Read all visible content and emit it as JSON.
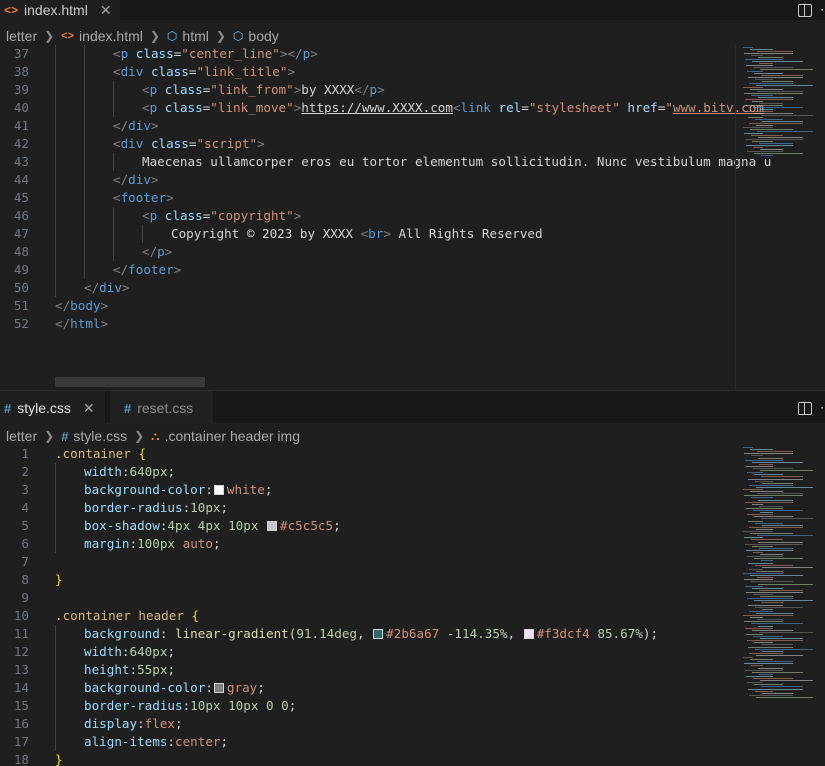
{
  "top_tabs": [
    {
      "icon": "html-file-icon",
      "label": "index.html",
      "close": "✕"
    }
  ],
  "top_breadcrumb": {
    "items": [
      {
        "label": "letter",
        "icon": ""
      },
      {
        "label": "index.html",
        "icon": "html-file-icon"
      },
      {
        "label": "html",
        "icon": "cube-icon"
      },
      {
        "label": "body",
        "icon": "cube-icon"
      }
    ]
  },
  "bottom_tabs": [
    {
      "icon": "#",
      "label": "style.css",
      "close": "✕",
      "active": true
    },
    {
      "icon": "#",
      "label": "reset.css",
      "close": "",
      "active": false
    }
  ],
  "bottom_breadcrumb": {
    "items": [
      {
        "label": "letter",
        "icon": ""
      },
      {
        "label": "style.css",
        "icon": "#"
      },
      {
        "label": ".container header img",
        "icon": "selector-icon"
      }
    ]
  },
  "html_editor": {
    "lines": [
      {
        "n": "37",
        "indent": 2,
        "tokens": [
          [
            "br",
            "<"
          ],
          [
            "tg",
            "p"
          ],
          [
            "tx",
            " "
          ],
          [
            "at",
            "class"
          ],
          [
            "tx",
            "="
          ],
          [
            "st",
            "\"center_line\""
          ],
          [
            "br",
            ">"
          ],
          [
            "br",
            "</"
          ],
          [
            "tg",
            "p"
          ],
          [
            "br",
            ">"
          ]
        ]
      },
      {
        "n": "38",
        "indent": 2,
        "tokens": [
          [
            "br",
            "<"
          ],
          [
            "tg",
            "div"
          ],
          [
            "tx",
            " "
          ],
          [
            "at",
            "class"
          ],
          [
            "tx",
            "="
          ],
          [
            "st",
            "\"link_title\""
          ],
          [
            "br",
            ">"
          ]
        ]
      },
      {
        "n": "39",
        "indent": 3,
        "tokens": [
          [
            "br",
            "<"
          ],
          [
            "tg",
            "p"
          ],
          [
            "tx",
            " "
          ],
          [
            "at",
            "class"
          ],
          [
            "tx",
            "="
          ],
          [
            "st",
            "\"link_from\""
          ],
          [
            "br",
            ">"
          ],
          [
            "tx",
            "by XXXX"
          ],
          [
            "br",
            "</"
          ],
          [
            "tg",
            "p"
          ],
          [
            "br",
            ">"
          ]
        ]
      },
      {
        "n": "40",
        "indent": 3,
        "tokens": [
          [
            "br",
            "<"
          ],
          [
            "tg",
            "p"
          ],
          [
            "tx",
            " "
          ],
          [
            "at",
            "class"
          ],
          [
            "tx",
            "="
          ],
          [
            "st",
            "\"link_move\""
          ],
          [
            "br",
            ">"
          ],
          [
            "tx ul",
            "https://www.XXXX.com"
          ],
          [
            "br",
            "<"
          ],
          [
            "tg",
            "link"
          ],
          [
            "tx",
            " "
          ],
          [
            "at",
            "rel"
          ],
          [
            "tx",
            "="
          ],
          [
            "st",
            "\"stylesheet\""
          ],
          [
            "tx",
            " "
          ],
          [
            "at",
            "href"
          ],
          [
            "tx",
            "="
          ],
          [
            "st",
            "\""
          ],
          [
            "st ul",
            "www.bitv.com"
          ]
        ]
      },
      {
        "n": "41",
        "indent": 2,
        "tokens": [
          [
            "br",
            "</"
          ],
          [
            "tg",
            "div"
          ],
          [
            "br",
            ">"
          ]
        ]
      },
      {
        "n": "42",
        "indent": 2,
        "tokens": [
          [
            "br",
            "<"
          ],
          [
            "tg",
            "div"
          ],
          [
            "tx",
            " "
          ],
          [
            "at",
            "class"
          ],
          [
            "tx",
            "="
          ],
          [
            "st",
            "\"script\""
          ],
          [
            "br",
            ">"
          ]
        ]
      },
      {
        "n": "43",
        "indent": 3,
        "tokens": [
          [
            "tx",
            "Maecenas ullamcorper eros eu tortor elementum sollicitudin. Nunc vestibulum magna u"
          ]
        ]
      },
      {
        "n": "44",
        "indent": 2,
        "tokens": [
          [
            "br",
            "</"
          ],
          [
            "tg",
            "div"
          ],
          [
            "br",
            ">"
          ]
        ]
      },
      {
        "n": "45",
        "indent": 2,
        "tokens": [
          [
            "br",
            "<"
          ],
          [
            "tg",
            "footer"
          ],
          [
            "br",
            ">"
          ]
        ]
      },
      {
        "n": "46",
        "indent": 3,
        "tokens": [
          [
            "br",
            "<"
          ],
          [
            "tg",
            "p"
          ],
          [
            "tx",
            " "
          ],
          [
            "at",
            "class"
          ],
          [
            "tx",
            "="
          ],
          [
            "st",
            "\"copyright\""
          ],
          [
            "br",
            ">"
          ]
        ]
      },
      {
        "n": "47",
        "indent": 4,
        "tokens": [
          [
            "tx",
            "Copyright © 2023 by XXXX "
          ],
          [
            "br",
            "<"
          ],
          [
            "tg",
            "br"
          ],
          [
            "br",
            ">"
          ],
          [
            "tx",
            " All Rights Reserved"
          ]
        ]
      },
      {
        "n": "48",
        "indent": 3,
        "tokens": [
          [
            "br",
            "</"
          ],
          [
            "tg",
            "p"
          ],
          [
            "br",
            ">"
          ]
        ]
      },
      {
        "n": "49",
        "indent": 2,
        "tokens": [
          [
            "br",
            "</"
          ],
          [
            "tg",
            "footer"
          ],
          [
            "br",
            ">"
          ]
        ]
      },
      {
        "n": "50",
        "indent": 1,
        "tokens": [
          [
            "br",
            "</"
          ],
          [
            "tg",
            "div"
          ],
          [
            "br",
            ">"
          ]
        ]
      },
      {
        "n": "51",
        "indent": 0,
        "tokens": [
          [
            "br",
            "</"
          ],
          [
            "tg",
            "body"
          ],
          [
            "br",
            ">"
          ]
        ]
      },
      {
        "n": "52",
        "indent": 0,
        "tokens": [
          [
            "br",
            "</"
          ],
          [
            "tg",
            "html"
          ],
          [
            "br",
            ">"
          ]
        ]
      }
    ]
  },
  "css_editor": {
    "lines": [
      {
        "n": "1",
        "indent": 0,
        "tokens": [
          [
            "sel",
            ".container"
          ],
          [
            "tx",
            " "
          ],
          [
            "pb",
            "{"
          ]
        ]
      },
      {
        "n": "2",
        "indent": 1,
        "tokens": [
          [
            "pr",
            "width"
          ],
          [
            "tx",
            ":"
          ],
          [
            "nm",
            "640px"
          ],
          [
            "tx",
            ";"
          ]
        ]
      },
      {
        "n": "3",
        "indent": 1,
        "tokens": [
          [
            "pr",
            "background-color"
          ],
          [
            "tx",
            ":"
          ],
          [
            "sw",
            "#ffffff"
          ],
          [
            "vl",
            "white"
          ],
          [
            "tx",
            ";"
          ]
        ]
      },
      {
        "n": "4",
        "indent": 1,
        "tokens": [
          [
            "pr",
            "border-radius"
          ],
          [
            "tx",
            ":"
          ],
          [
            "nm",
            "10px"
          ],
          [
            "tx",
            ";"
          ]
        ]
      },
      {
        "n": "5",
        "indent": 1,
        "tokens": [
          [
            "pr",
            "box-shadow"
          ],
          [
            "tx",
            ":"
          ],
          [
            "nm",
            "4px 4px 10px"
          ],
          [
            "tx",
            " "
          ],
          [
            "sw",
            "#c5c5c5"
          ],
          [
            "vl",
            "#c5c5c5"
          ],
          [
            "tx",
            ";"
          ]
        ]
      },
      {
        "n": "6",
        "indent": 1,
        "tokens": [
          [
            "pr",
            "margin"
          ],
          [
            "tx",
            ":"
          ],
          [
            "nm",
            "100px"
          ],
          [
            "tx",
            " "
          ],
          [
            "vl",
            "auto"
          ],
          [
            "tx",
            ";"
          ]
        ]
      },
      {
        "n": "7",
        "indent": 0,
        "tokens": []
      },
      {
        "n": "8",
        "indent": 0,
        "tokens": [
          [
            "pb",
            "}"
          ]
        ]
      },
      {
        "n": "9",
        "indent": 0,
        "tokens": []
      },
      {
        "n": "10",
        "indent": 0,
        "tokens": [
          [
            "sel",
            ".container header"
          ],
          [
            "tx",
            " "
          ],
          [
            "pb",
            "{"
          ]
        ]
      },
      {
        "n": "11",
        "indent": 1,
        "tokens": [
          [
            "pr",
            "background"
          ],
          [
            "tx",
            ": "
          ],
          [
            "fn",
            "linear-gradient"
          ],
          [
            "tx",
            "("
          ],
          [
            "nm",
            "91.14deg"
          ],
          [
            "tx",
            ", "
          ],
          [
            "sw",
            "#2b6a67"
          ],
          [
            "vl",
            "#2b6a67"
          ],
          [
            "tx",
            " "
          ],
          [
            "nm",
            "-114.35%"
          ],
          [
            "tx",
            ", "
          ],
          [
            "sw",
            "#f3dcf4"
          ],
          [
            "vl",
            "#f3dcf4"
          ],
          [
            "tx",
            " "
          ],
          [
            "nm",
            "85.67%"
          ],
          [
            "tx",
            ");"
          ]
        ]
      },
      {
        "n": "12",
        "indent": 1,
        "tokens": [
          [
            "pr",
            "width"
          ],
          [
            "tx",
            ":"
          ],
          [
            "nm",
            "640px"
          ],
          [
            "tx",
            ";"
          ]
        ]
      },
      {
        "n": "13",
        "indent": 1,
        "tokens": [
          [
            "pr",
            "height"
          ],
          [
            "tx",
            ":"
          ],
          [
            "nm",
            "55px"
          ],
          [
            "tx",
            ";"
          ]
        ]
      },
      {
        "n": "14",
        "indent": 1,
        "tokens": [
          [
            "pr",
            "background-color"
          ],
          [
            "tx",
            ":"
          ],
          [
            "sw",
            "#808080"
          ],
          [
            "vl",
            "gray"
          ],
          [
            "tx",
            ";"
          ]
        ]
      },
      {
        "n": "15",
        "indent": 1,
        "tokens": [
          [
            "pr",
            "border-radius"
          ],
          [
            "tx",
            ":"
          ],
          [
            "nm",
            "10px 10px 0 0"
          ],
          [
            "tx",
            ";"
          ]
        ]
      },
      {
        "n": "16",
        "indent": 1,
        "tokens": [
          [
            "pr",
            "display"
          ],
          [
            "tx",
            ":"
          ],
          [
            "vl",
            "flex"
          ],
          [
            "tx",
            ";"
          ]
        ]
      },
      {
        "n": "17",
        "indent": 1,
        "tokens": [
          [
            "pr",
            "align-items"
          ],
          [
            "tx",
            ":"
          ],
          [
            "vl",
            "center"
          ],
          [
            "tx",
            ";"
          ]
        ]
      },
      {
        "n": "18",
        "indent": 0,
        "tokens": [
          [
            "pb",
            "}"
          ]
        ]
      }
    ]
  },
  "colors": {
    "editor_bg": "#1f1f1f",
    "tabbar_bg": "#181818",
    "accent": "#519aba"
  }
}
